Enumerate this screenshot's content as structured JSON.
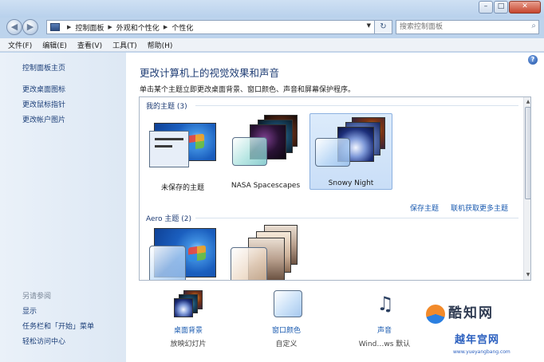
{
  "window": {
    "minimize": "–",
    "maximize": "□",
    "close": "✕"
  },
  "address": {
    "breadcrumb": [
      "控制面板",
      "外观和个性化",
      "个性化"
    ],
    "search_placeholder": "搜索控制面板"
  },
  "menu": [
    "文件(F)",
    "编辑(E)",
    "查看(V)",
    "工具(T)",
    "帮助(H)"
  ],
  "sidebar": {
    "home": "控制面板主页",
    "links": [
      "更改桌面图标",
      "更改鼠标指针",
      "更改帐户图片"
    ],
    "see_also_heading": "另请参阅",
    "see_also": [
      "显示",
      "任务栏和「开始」菜单",
      "轻松访问中心"
    ]
  },
  "main": {
    "title": "更改计算机上的视觉效果和声音",
    "description": "单击某个主题立即更改桌面背景、窗口颜色、声音和屏幕保护程序。",
    "my_themes_header": "我的主题 (3)",
    "aero_themes_header": "Aero 主题 (2)",
    "my_themes": [
      {
        "label": "未保存的主题",
        "selected": false
      },
      {
        "label": "NASA Spacescapes",
        "selected": false
      },
      {
        "label": "Snowy Night",
        "selected": true
      }
    ],
    "save_theme": "保存主题",
    "get_more_themes": "联机获取更多主题"
  },
  "quick": [
    {
      "title": "桌面背景",
      "sub": "放映幻灯片",
      "icon": "desktop-background-icon"
    },
    {
      "title": "窗口颜色",
      "sub": "自定义",
      "icon": "window-color-icon"
    },
    {
      "title": "声音",
      "sub": "Wind…ws 默认",
      "icon": "sound-icon"
    }
  ],
  "watermark": {
    "brand1": "酷知网",
    "brand2": "越年宫网",
    "url": "www.yueyangbang.com"
  },
  "colors": {
    "accent_blue": "#1e3c74",
    "link_blue": "#1b5bb0",
    "sidebar_bg": "#e3ecf6",
    "selection_bg": "#d4e6fa"
  }
}
